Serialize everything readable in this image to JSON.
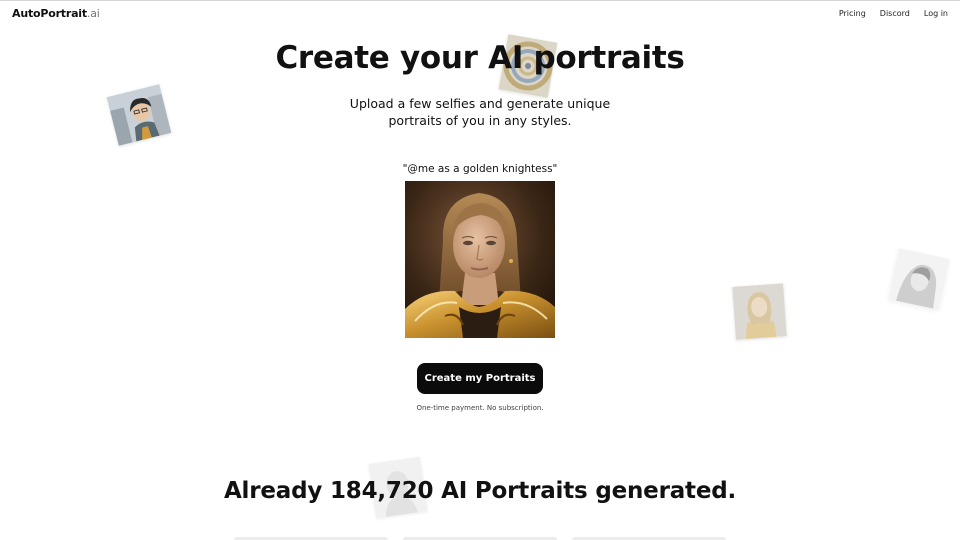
{
  "header": {
    "brand_main": "AutoPortrait",
    "brand_suffix": ".ai",
    "nav": [
      "Pricing",
      "Discord",
      "Log in"
    ]
  },
  "hero": {
    "title": "Create your AI portraits",
    "subtitle": "Upload a few selfies and generate unique portraits of you in any styles."
  },
  "example": {
    "prompt": "\"@me as a golden knightess\""
  },
  "cta": {
    "label": "Create my Portraits",
    "note": "One-time payment. No subscription."
  },
  "stats": {
    "headline": "Already 184,720 AI Portraits generated."
  },
  "colors": {
    "button_bg": "#0b0b0b",
    "button_text": "#ffffff",
    "text": "#111111",
    "gold": "#c9912e"
  }
}
